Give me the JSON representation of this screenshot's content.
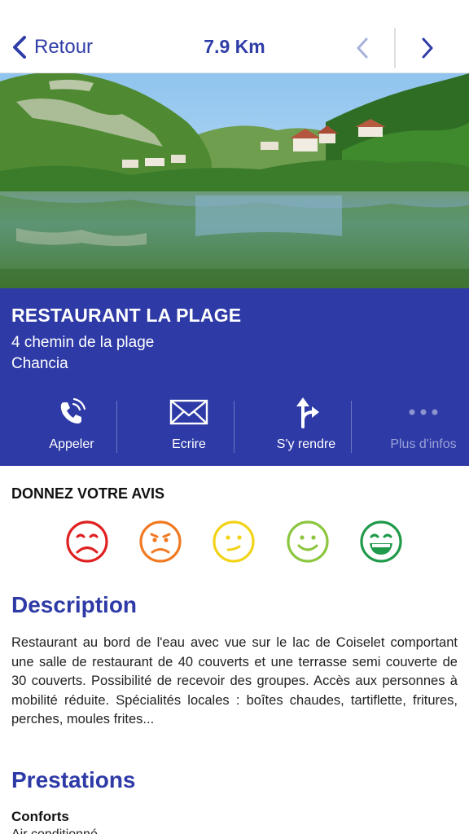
{
  "header": {
    "back_label": "Retour",
    "distance": "7.9 Km",
    "accent_color": "#2f3da8",
    "back_icon": "chevron-left-icon",
    "prev_icon": "chevron-left-icon",
    "next_icon": "chevron-right-icon"
  },
  "gallery": {
    "pages": 2,
    "current_page": 1
  },
  "place": {
    "name": "RESTAURANT LA PLAGE",
    "address_line1": "4  chemin de la plage",
    "address_line2": "Chancia",
    "panel_color": "#2e3aa6"
  },
  "actions": [
    {
      "label": "Appeler",
      "icon": "phone-icon",
      "enabled": true
    },
    {
      "label": "Ecrire",
      "icon": "envelope-icon",
      "enabled": true
    },
    {
      "label": "S'y rendre",
      "icon": "directions-icon",
      "enabled": true
    },
    {
      "label": "Plus d'infos",
      "icon": "more-dots-icon",
      "enabled": false
    }
  ],
  "review": {
    "title": "DONNEZ VOTRE AVIS",
    "options": [
      {
        "name": "very-bad",
        "color": "#e02020"
      },
      {
        "name": "bad",
        "color": "#f07a22"
      },
      {
        "name": "neutral",
        "color": "#f2d318"
      },
      {
        "name": "good",
        "color": "#8cc63f"
      },
      {
        "name": "very-good",
        "color": "#1f9a4a"
      }
    ]
  },
  "description": {
    "title": "Description",
    "text": "Restaurant au bord de l'eau avec vue sur le lac de Coiselet comportant une salle de restaurant de 40 couverts et une terrasse semi couverte de 30 couverts. Possibilité de recevoir des groupes. Accès aux personnes à mobilité réduite. Spécialités locales : boîtes chaudes, tartiflette, fritures, perches, moules frites..."
  },
  "prestations": {
    "title": "Prestations",
    "subtitle": "Conforts",
    "first_item": "Air conditionné"
  }
}
